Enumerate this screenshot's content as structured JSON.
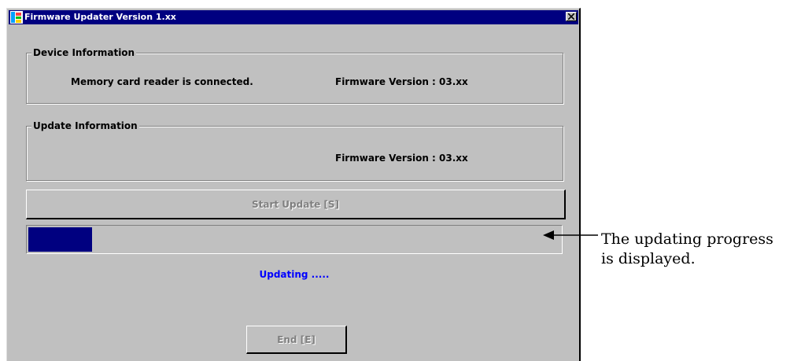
{
  "window": {
    "title": "Firmware Updater Version 1.xx",
    "close_label": "close"
  },
  "device_info": {
    "label": "Device Information",
    "status": "Memory card reader is connected.",
    "firmware": "Firmware Version : 03.xx"
  },
  "update_info": {
    "label": "Update Information",
    "firmware": "Firmware Version : 03.xx"
  },
  "buttons": {
    "start_update": "Start Update [S]",
    "end": "End [E]"
  },
  "progress": {
    "fraction": 0.12,
    "status_text": "Updating .....",
    "status_color": "#0000ff",
    "fill_color": "#000080"
  },
  "annotation": {
    "line1": "The updating progress",
    "line2": "is displayed."
  }
}
